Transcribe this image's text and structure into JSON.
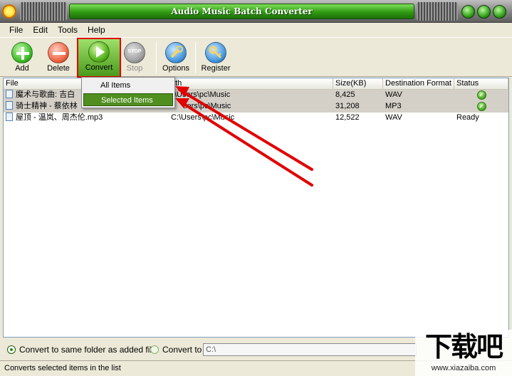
{
  "window": {
    "title": "Audio Music Batch Converter"
  },
  "menu": {
    "items": [
      "File",
      "Edit",
      "Tools",
      "Help"
    ]
  },
  "toolbar": {
    "add_label": "Add",
    "delete_label": "Delete",
    "convert_label": "Convert",
    "stop_label": "Stop",
    "stop_icon_text": "STOP",
    "options_label": "Options",
    "register_label": "Register"
  },
  "convert_menu": {
    "items": [
      "All Items",
      "Selected Items"
    ],
    "highlighted_index": 1
  },
  "table": {
    "columns": [
      "File",
      "Path",
      "Size(KB)",
      "Destination Format",
      "Status"
    ],
    "visible_header_fragments": {
      "path": "ath"
    },
    "rows": [
      {
        "file": "魔术与歌曲: 吉白",
        "path": "C:\\Users\\pc\\Music",
        "path_visible": "\\Users\\pc\\Music",
        "size": "8,425",
        "format": "WAV",
        "status": "",
        "status_icon": "check-icon"
      },
      {
        "file": "骑士精神 - 蔡依林",
        "path": "C:\\Users\\pc\\Music",
        "path_visible": "sers\\pc\\Music",
        "size": "31,208",
        "format": "MP3",
        "status": "",
        "status_icon": "check-icon"
      },
      {
        "file": "屋顶 - 温岚、周杰伦.mp3",
        "path": "C:\\Users\\pc\\Music",
        "path_visible": "C:\\Users\\pc\\Music",
        "size": "12,522",
        "format": "WAV",
        "status": "Ready",
        "status_icon": ""
      }
    ]
  },
  "output": {
    "option_same_folder": "Convert to same folder as added file",
    "option_convert_to": "Convert to",
    "path_value": "C:\\"
  },
  "status": {
    "text": "Converts selected items in the list"
  },
  "watermark": {
    "logo": "下载吧",
    "url": "www.xiazaiba.com"
  },
  "colors": {
    "accent_green": "#4f8e1f",
    "annotation_red": "#e00000",
    "title_green": "#2f9a12"
  }
}
